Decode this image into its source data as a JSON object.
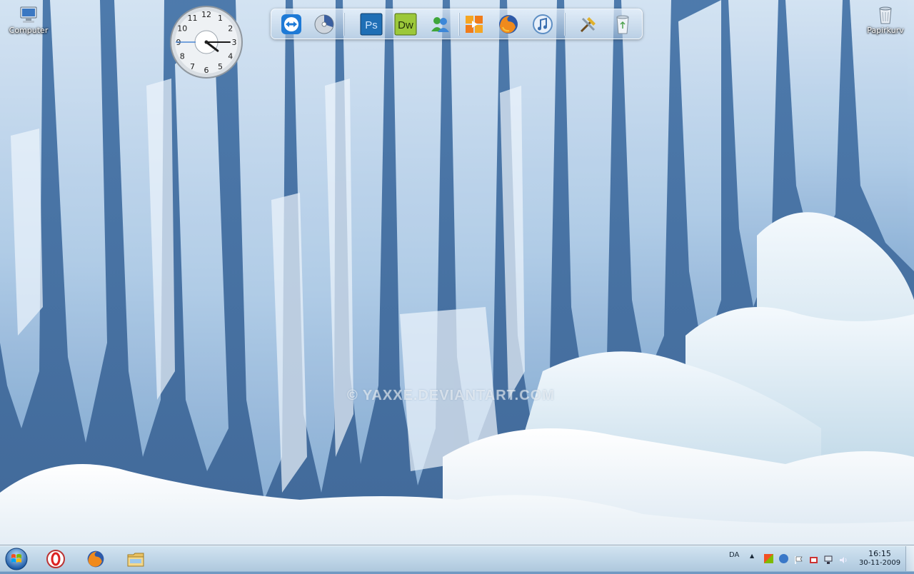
{
  "desktop": {
    "icons": [
      {
        "label": "Computer",
        "icon": "computer-icon"
      },
      {
        "label": "Papirkurv",
        "icon": "recycle-bin-icon"
      }
    ],
    "watermark": "© YAXXE.DEVIANTART.COM"
  },
  "clock_gadget": {
    "numbers": [
      "12",
      "1",
      "2",
      "3",
      "4",
      "5",
      "6",
      "7",
      "8",
      "9",
      "10",
      "11"
    ],
    "hour": 4,
    "minute": 15
  },
  "dock": {
    "items": [
      {
        "name": "teamviewer-icon"
      },
      {
        "name": "disk-icon"
      },
      {
        "name": "photoshop-icon",
        "label": "Ps"
      },
      {
        "name": "dreamweaver-icon",
        "label": "Dw"
      },
      {
        "name": "messenger-icon"
      },
      {
        "name": "media-center-icon"
      },
      {
        "name": "firefox-icon"
      },
      {
        "name": "itunes-icon"
      },
      {
        "name": "tools-icon"
      },
      {
        "name": "recycle-bin-icon"
      }
    ]
  },
  "taskbar": {
    "pinned": [
      {
        "name": "start-button"
      },
      {
        "name": "opera-icon"
      },
      {
        "name": "firefox-icon"
      },
      {
        "name": "explorer-icon"
      }
    ],
    "tray": {
      "language": "DA",
      "time": "16:15",
      "date": "30-11-2009"
    }
  },
  "colors": {
    "photoshop": "#1f6fb5",
    "dreamweaver": "#6a9f1c",
    "taskbar": "#b9d0e3"
  }
}
